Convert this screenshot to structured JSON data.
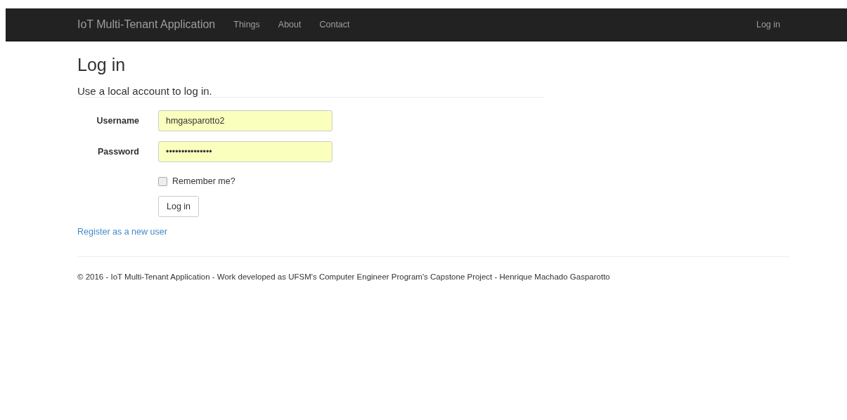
{
  "navbar": {
    "brand": "IoT Multi-Tenant Application",
    "links": [
      {
        "label": "Things"
      },
      {
        "label": "About"
      },
      {
        "label": "Contact"
      }
    ],
    "right_link": "Log in"
  },
  "page": {
    "title": "Log in",
    "subtitle": "Use a local account to log in."
  },
  "form": {
    "fields": [
      {
        "label": "Username",
        "value": "hmgasparotto2"
      },
      {
        "label": "Password",
        "value": "•••••••••••••••"
      }
    ],
    "remember": {
      "label": "Remember me?",
      "checked": false
    },
    "submit": "Log in"
  },
  "register_link": "Register as a new user",
  "footer": "© 2016 - IoT Multi-Tenant Application - Work developed as UFSM's Computer Engineer Program's Capstone Project - Henrique Machado Gasparotto"
}
